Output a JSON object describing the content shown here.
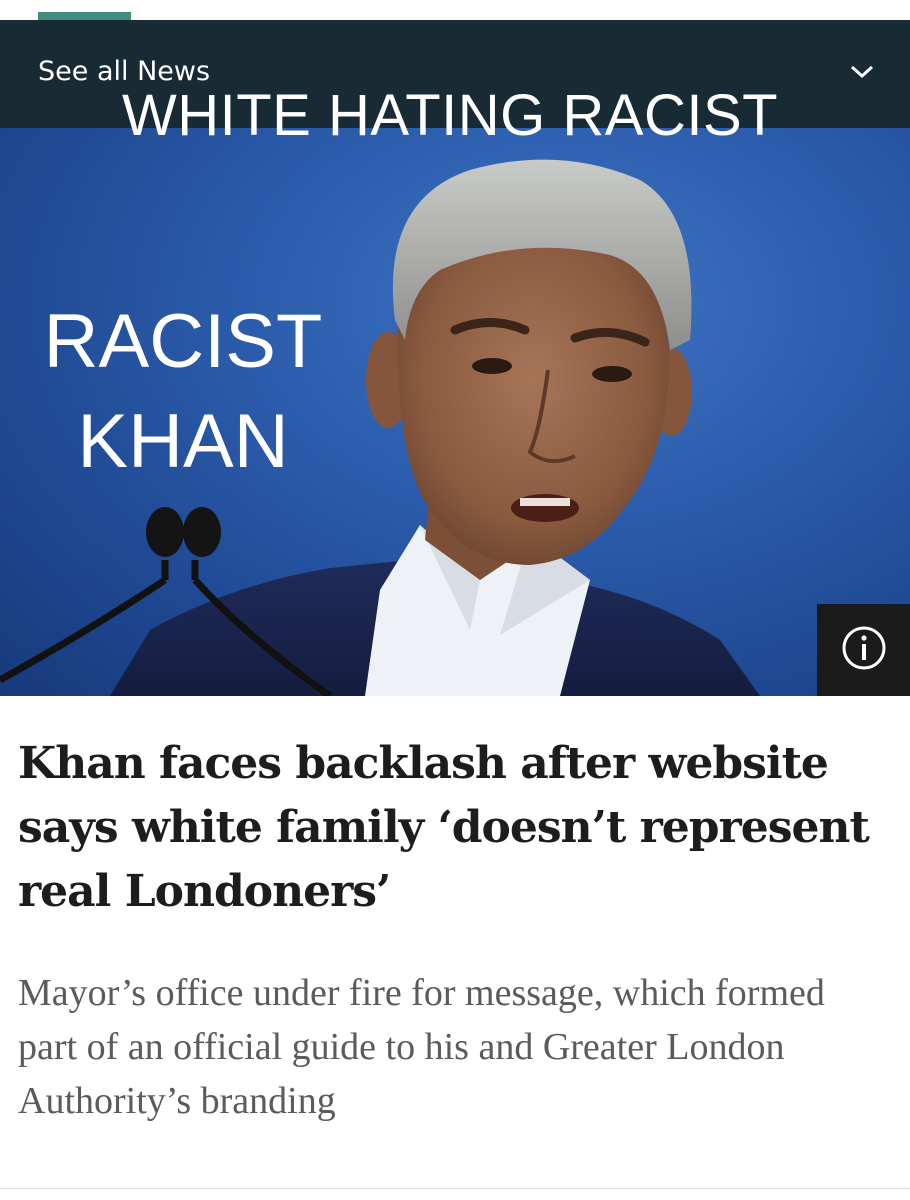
{
  "nav": {
    "see_all_label": "See all News"
  },
  "hero": {
    "overlay_top": "WHITE HATING RACIST",
    "overlay_left_line1": "RACIST",
    "overlay_left_line2": "KHAN",
    "info_icon": "info-icon",
    "chevron_icon": "chevron-down-icon"
  },
  "article": {
    "headline": "Khan faces backlash after website says white family ‘doesn’t represent real Londoners’",
    "standfirst": "Mayor’s office under fire for message, which formed part of an official guide to his and Greater London Authority’s branding"
  },
  "colors": {
    "nav_bg": "#182a33",
    "accent": "#3f8e7d",
    "headline": "#1d1d1d",
    "standfirst": "#5b5b5b",
    "hero_blue": "#2b5cab"
  }
}
